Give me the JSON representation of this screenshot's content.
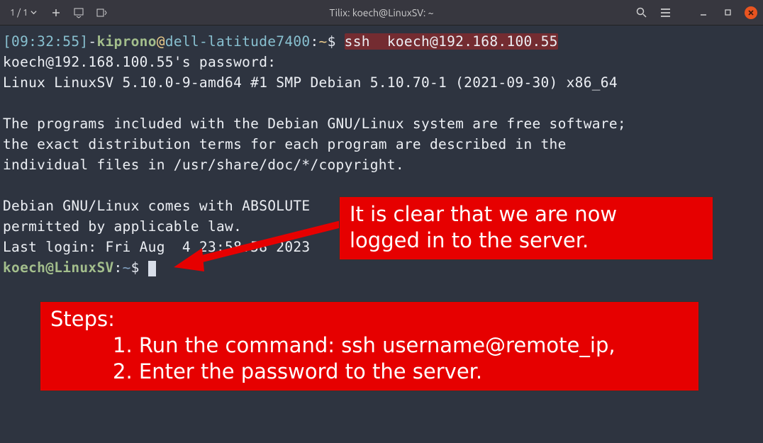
{
  "titlebar": {
    "count": "1 / 1",
    "title": "Tilix: koech@LinuxSV: ~"
  },
  "prompt1": {
    "time": "[09:32:55]",
    "dash": "-",
    "user": "kiprono",
    "at": "@",
    "host": "dell-latitude7400",
    "colon": ":",
    "path": "~",
    "dollar": "$",
    "cmd": "ssh  koech@192.168.100.55"
  },
  "output": {
    "l1": "koech@192.168.100.55's password:",
    "l2": "Linux LinuxSV 5.10.0-9-amd64 #1 SMP Debian 5.10.70-1 (2021-09-30) x86_64",
    "l3": "",
    "l4": "The programs included with the Debian GNU/Linux system are free software;",
    "l5": "the exact distribution terms for each program are described in the",
    "l6": "individual files in /usr/share/doc/*/copyright.",
    "l7": "",
    "l8": "Debian GNU/Linux comes with ABSOLUTE",
    "l9": "permitted by applicable law.",
    "l10": "Last login: Fri Aug  4 23:58:58 2023"
  },
  "prompt2": {
    "user": "koech",
    "at": "@",
    "host": "LinuxSV",
    "colon": ":",
    "path": "~",
    "dollar": "$"
  },
  "annotation1": {
    "line1": "It is clear that we are now",
    "line2": "logged in to the server."
  },
  "annotation2": {
    "heading": "Steps:",
    "step1": "1. Run the command: ssh username@remote_ip,",
    "step2": "2. Enter the password to the server."
  }
}
